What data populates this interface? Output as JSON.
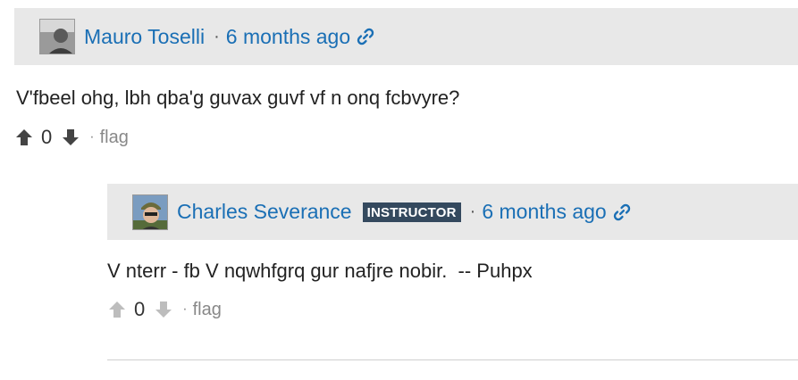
{
  "posts": [
    {
      "author": "Mauro Toselli",
      "time": "6 months ago",
      "body": "V'fbeel ohg, lbh qba'g guvax guvf vf n onq fcbvyre?",
      "score": "0",
      "flag_label": "flag",
      "icons": {
        "link": "link-icon",
        "up": "arrow-up-icon",
        "down": "arrow-down-icon"
      }
    },
    {
      "author": "Charles Severance",
      "badge": "INSTRUCTOR",
      "time": "6 months ago",
      "body": "V nterr - fb V nqwhfgrq gur nafjre nobir.  -- Puhpx",
      "score": "0",
      "flag_label": "flag",
      "icons": {
        "link": "link-icon",
        "up": "arrow-up-icon",
        "down": "arrow-down-icon"
      }
    }
  ],
  "separator": "·",
  "colors": {
    "link": "#1a6fb5",
    "header_bg": "#e8e8e8",
    "badge_bg": "#34495e",
    "muted": "#888888"
  }
}
